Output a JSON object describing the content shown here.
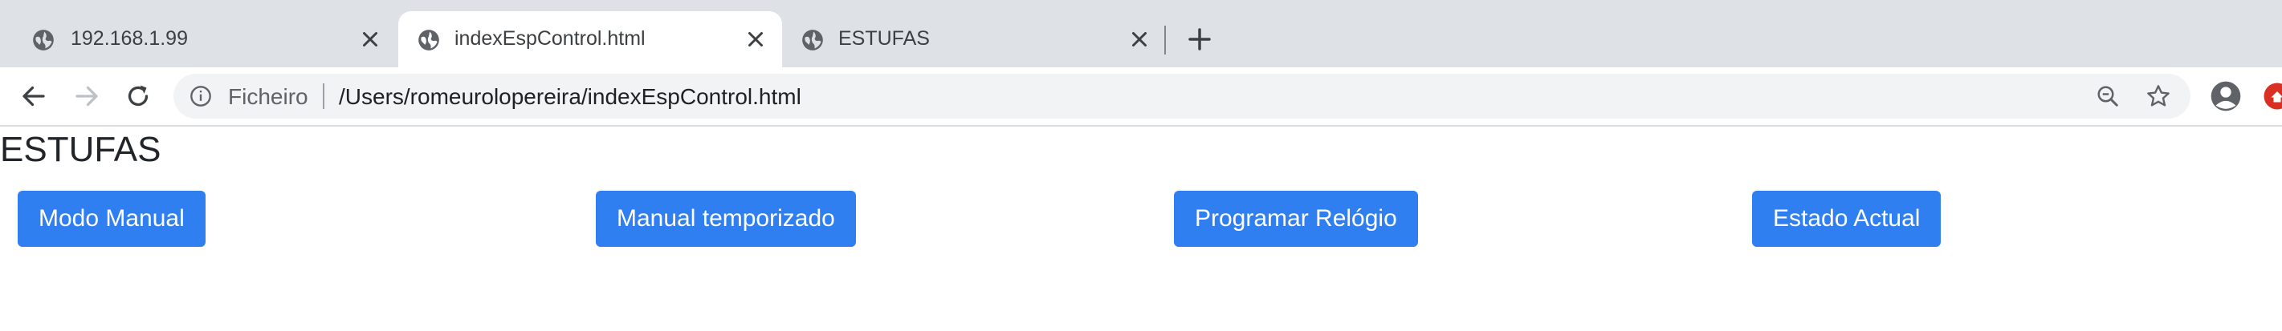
{
  "tabs": [
    {
      "title": "192.168.1.99",
      "active": false,
      "favicon": "globe-icon"
    },
    {
      "title": "indexEspControl.html",
      "active": true,
      "favicon": "globe-icon"
    },
    {
      "title": "ESTUFAS",
      "active": false,
      "favicon": "globe-icon"
    }
  ],
  "toolbar": {
    "scheme_label": "Ficheiro",
    "url": "/Users/romeurolopereira/indexEspControl.html"
  },
  "page": {
    "heading": "ESTUFAS",
    "buttons": [
      {
        "label": "Modo Manual"
      },
      {
        "label": "Manual temporizado"
      },
      {
        "label": "Programar Relógio"
      },
      {
        "label": "Estado Actual"
      }
    ]
  },
  "colors": {
    "tabstrip_bg": "#dee1e6",
    "button_bg": "#2f7ff0",
    "button_text": "#ffffff",
    "heading_text": "#212529"
  },
  "icons": [
    "globe-icon",
    "close-icon",
    "plus-icon",
    "back-arrow-icon",
    "forward-arrow-icon",
    "reload-icon",
    "info-icon",
    "zoom-out-icon",
    "star-icon",
    "profile-icon",
    "extension-icon"
  ]
}
